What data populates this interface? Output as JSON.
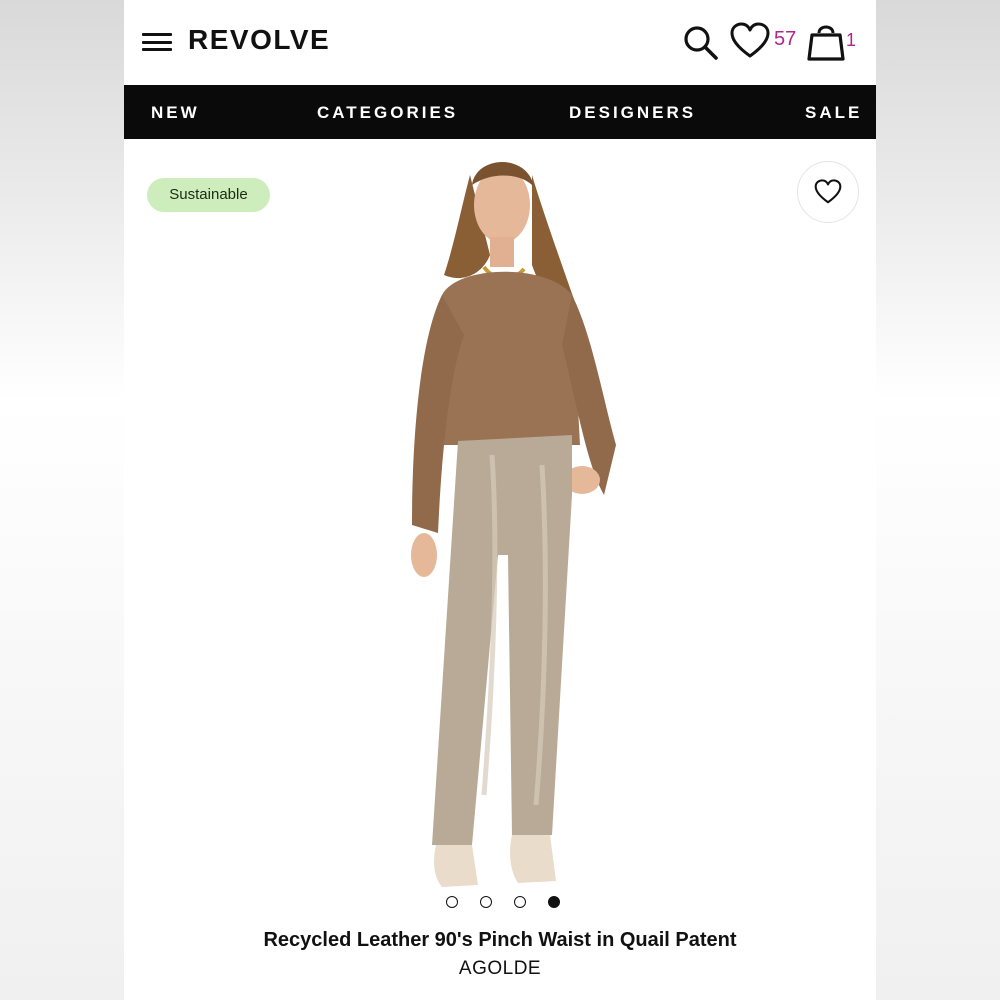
{
  "header": {
    "logo": "REVOLVE",
    "wishlist_count": "57",
    "bag_count": "1"
  },
  "nav": {
    "items": [
      "NEW",
      "CATEGORIES",
      "DESIGNERS",
      "SALE"
    ]
  },
  "product": {
    "badge": "Sustainable",
    "title": "Recycled Leather 90's Pinch Waist in Quail Patent",
    "brand": "AGOLDE",
    "carousel": {
      "total": 4,
      "active_index": 4
    }
  },
  "colors": {
    "accent_count": "#b0268f",
    "nav_bg": "#0a0a0a",
    "badge_bg": "#cdeebc"
  },
  "icons": [
    "menu-icon",
    "search-icon",
    "heart-icon",
    "shopping-bag-icon",
    "heart-outline-icon"
  ]
}
